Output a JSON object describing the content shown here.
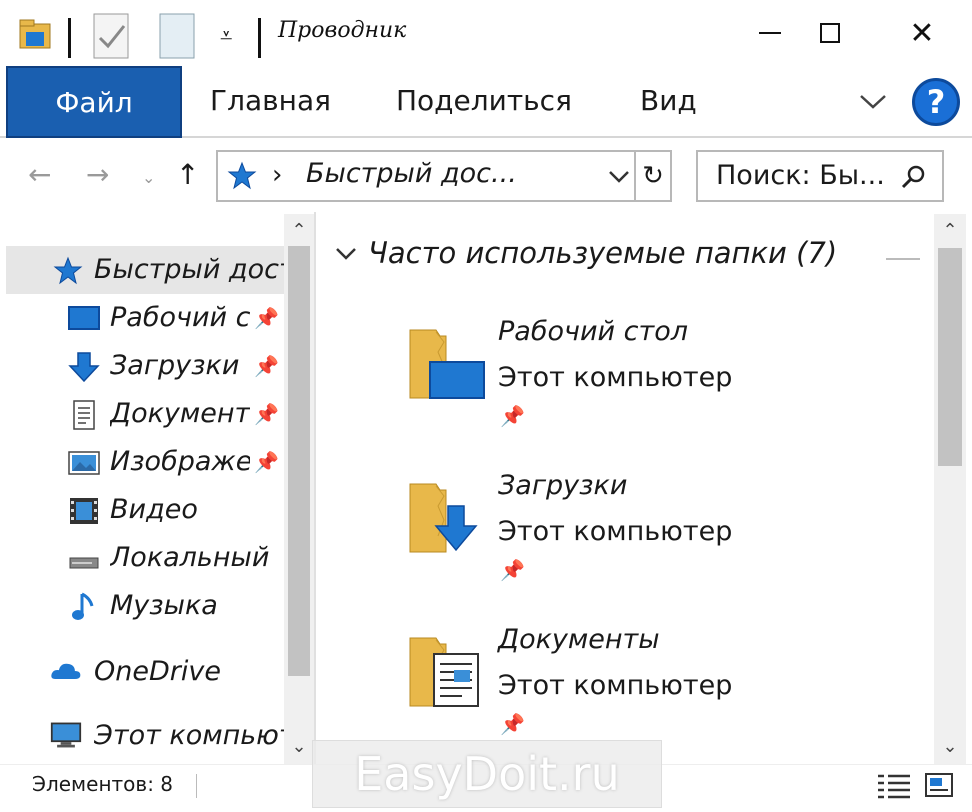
{
  "window": {
    "title": "Проводник",
    "minimize_icon": "minimize-icon",
    "maximize_icon": "maximize-icon",
    "close_icon": "close-icon"
  },
  "quick_access_toolbar": {
    "icons": [
      "folder-properties-icon",
      "checkmark-doc-icon",
      "new-folder-icon",
      "customize-dropdown-icon"
    ]
  },
  "ribbon": {
    "file_tab": "Файл",
    "tabs": [
      "Главная",
      "Поделиться",
      "Вид"
    ],
    "expand_icon": "chevron-down-icon",
    "help_label": "?"
  },
  "address_bar": {
    "path_icon": "quick-access-star-icon",
    "separator": "›",
    "path": "Быстрый дос...",
    "dropdown_icon": "chevron-down-icon",
    "refresh_icon": "refresh-icon"
  },
  "search": {
    "placeholder": "Поиск: Бы...",
    "icon": "search-icon"
  },
  "nav_pane": {
    "items": [
      {
        "label": "Быстрый доступ",
        "icon": "quick-access-star-icon",
        "pinned": false
      },
      {
        "label": "Рабочий стол",
        "icon": "desktop-icon",
        "pinned": true
      },
      {
        "label": "Загрузки",
        "icon": "downloads-icon",
        "pinned": true
      },
      {
        "label": "Документы",
        "icon": "documents-icon",
        "pinned": true
      },
      {
        "label": "Изображения",
        "icon": "pictures-icon",
        "pinned": true
      },
      {
        "label": "Видео",
        "icon": "video-icon",
        "pinned": false
      },
      {
        "label": "Локальный диск",
        "icon": "drive-icon",
        "pinned": false
      },
      {
        "label": "Музыка",
        "icon": "music-icon",
        "pinned": false
      },
      {
        "label": "OneDrive",
        "icon": "onedrive-icon",
        "pinned": false
      },
      {
        "label": "Этот компьютер",
        "icon": "computer-icon",
        "pinned": false
      }
    ]
  },
  "content": {
    "group_header": "Часто используемые папки (7)",
    "folders": [
      {
        "name": "Рабочий стол",
        "location": "Этот компьютер",
        "icon": "desktop-folder-icon"
      },
      {
        "name": "Загрузки",
        "location": "Этот компьютер",
        "icon": "downloads-folder-icon"
      },
      {
        "name": "Документы",
        "location": "Этот компьютер",
        "icon": "documents-folder-icon"
      }
    ]
  },
  "status_bar": {
    "items_count": "Элементов: 8",
    "details_view_icon": "details-view-icon",
    "large-icons-view-icon": "large-icons-view-icon"
  },
  "watermark": "EasyDoit.ru",
  "colors": {
    "file_tab": "#1a5fb0",
    "help": "#1a6fd6",
    "folder": "#e8b84a",
    "accent_blue": "#1f78d1"
  }
}
